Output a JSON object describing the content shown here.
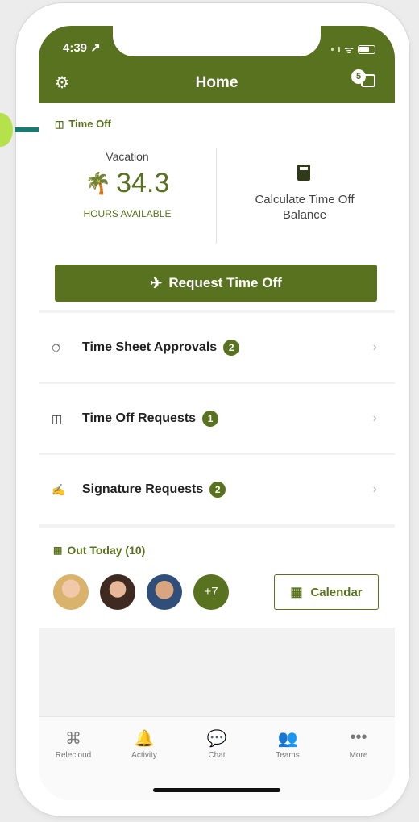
{
  "status": {
    "time": "4:39 ↗"
  },
  "header": {
    "title": "Home",
    "settings_icon": "gear-icon",
    "contacts_icon": "chat-contacts-icon",
    "contacts_badge": "5"
  },
  "time_off": {
    "section_label": "Time Off",
    "vacation_label": "Vacation",
    "hours": "34.3",
    "hours_caption": "HOURS AVAILABLE",
    "calculate_label": "Calculate Time Off Balance",
    "request_button": "Request Time Off"
  },
  "list": [
    {
      "label": "Time Sheet Approvals",
      "count": "2",
      "icon": "timesheet-icon"
    },
    {
      "label": "Time Off Requests",
      "count": "1",
      "icon": "timeoff-icon"
    },
    {
      "label": "Signature Requests",
      "count": "2",
      "icon": "signature-icon"
    }
  ],
  "out_today": {
    "label": "Out Today (10)",
    "more_count": "+7",
    "calendar_button": "Calendar"
  },
  "nav": [
    {
      "label": "Relecloud",
      "icon": "app-icon"
    },
    {
      "label": "Activity",
      "icon": "bell-icon"
    },
    {
      "label": "Chat",
      "icon": "chat-icon"
    },
    {
      "label": "Teams",
      "icon": "teams-icon"
    },
    {
      "label": "More",
      "icon": "more-icon"
    }
  ],
  "colors": {
    "accent": "#59721f",
    "annotation_arrow": "#187a70",
    "annotation_dot": "#b5e24a"
  }
}
